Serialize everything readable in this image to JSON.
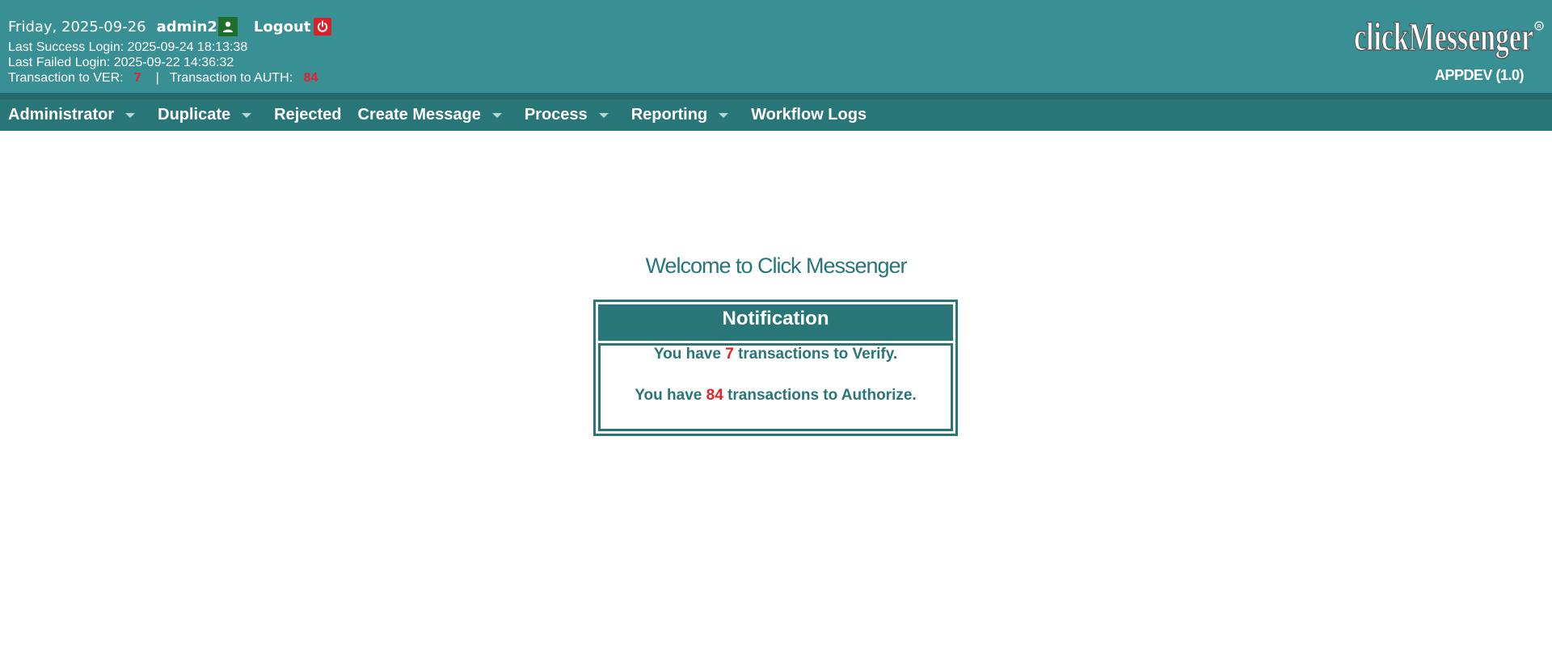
{
  "header": {
    "date": "Friday, 2025-09-26",
    "username": "admin2",
    "logout_label": "Logout",
    "last_success": "Last Success Login: 2025-09-24 18:13:38",
    "last_failed": "Last Failed Login: 2025-09-22 14:36:32",
    "ver_label": "Transaction to VER:",
    "ver_count": "7",
    "separator": "|",
    "auth_label": "Transaction to AUTH:",
    "auth_count": "84",
    "logo_text": "clickMessenger",
    "environment": "APPDEV (1.0)"
  },
  "menu": {
    "administrator": "Administrator",
    "duplicate": "Duplicate",
    "rejected": "Rejected",
    "create_message": "Create Message",
    "process": "Process",
    "reporting": "Reporting",
    "workflow_logs": "Workflow Logs"
  },
  "main": {
    "welcome": "Welcome to Click Messenger",
    "notification_title": "Notification",
    "verify_prefix": "You have",
    "verify_count": "7",
    "verify_suffix": "transactions to Verify.",
    "auth_prefix": "You have",
    "auth_count": "84",
    "auth_suffix": "transactions to Authorize."
  },
  "colors": {
    "header_bg": "#388f94",
    "menu_bg": "#287678",
    "accent_red": "#e8202a",
    "text_teal": "#287678"
  },
  "icons": {
    "user": "user-icon",
    "logout": "power-icon",
    "dropdown": "caret-down-icon"
  }
}
